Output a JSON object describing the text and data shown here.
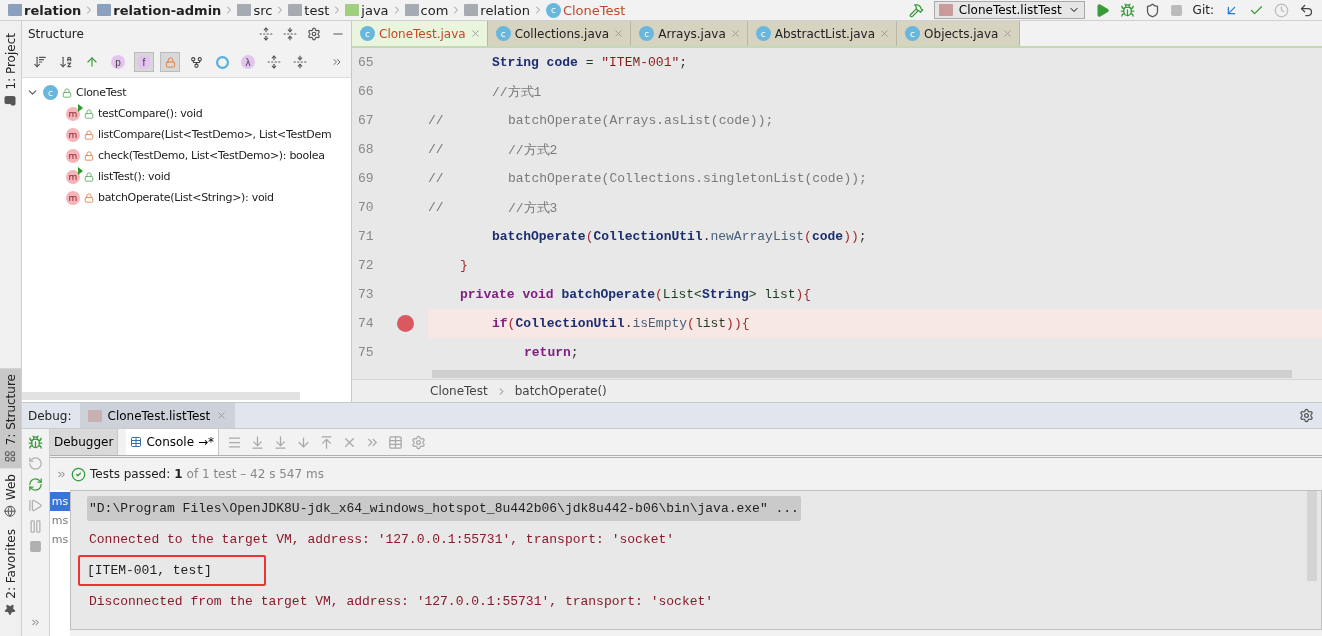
{
  "breadcrumbs": [
    {
      "label": "relation",
      "kind": "module"
    },
    {
      "label": "relation-admin",
      "kind": "module"
    },
    {
      "label": "src",
      "kind": "folder"
    },
    {
      "label": "test",
      "kind": "folder"
    },
    {
      "label": "java",
      "kind": "source"
    },
    {
      "label": "com",
      "kind": "package"
    },
    {
      "label": "relation",
      "kind": "package"
    },
    {
      "label": "CloneTest",
      "kind": "class",
      "badge": "c"
    }
  ],
  "run_config": {
    "label": "CloneTest.listTest"
  },
  "vcs": {
    "label": "Git:"
  },
  "tool_windows": [
    {
      "label": "1: Project",
      "kind": "project",
      "selected": false
    },
    {
      "label": "7: Structure",
      "kind": "structure",
      "selected": true
    },
    {
      "label": "Web",
      "kind": "web",
      "selected": false
    },
    {
      "label": "2: Favorites",
      "kind": "favorites",
      "selected": false
    }
  ],
  "structure": {
    "title": "Structure",
    "toolbar": [
      {
        "kind": "sort-visibility",
        "on": false
      },
      {
        "kind": "sort-alpha",
        "on": false
      },
      {
        "kind": "inherited",
        "on": false
      },
      {
        "kind": "letter",
        "glyph": "p",
        "on": false
      },
      {
        "kind": "letter",
        "glyph": "f",
        "on": true
      },
      {
        "kind": "lock",
        "on": true
      },
      {
        "kind": "fork",
        "on": false
      },
      {
        "kind": "ring",
        "on": false
      },
      {
        "kind": "letter",
        "glyph": "λ",
        "on": false
      },
      {
        "kind": "expand",
        "on": false
      },
      {
        "kind": "collapse",
        "on": false
      }
    ],
    "tree": [
      {
        "label": "CloneTest",
        "badge": "c",
        "expanded": true,
        "children": [
          {
            "label": "testCompare(): void",
            "badge": "m",
            "private": false,
            "runnable": true
          },
          {
            "label": "listCompare(List<TestDemo>, List<TestDem",
            "badge": "m",
            "private": true,
            "runnable": false
          },
          {
            "label": "check(TestDemo, List<TestDemo>): boolea",
            "badge": "m",
            "private": true,
            "runnable": false
          },
          {
            "label": "listTest(): void",
            "badge": "m",
            "private": false,
            "runnable": true
          },
          {
            "label": "batchOperate(List<String>): void",
            "badge": "m",
            "private": true,
            "runnable": false
          }
        ]
      }
    ]
  },
  "editor": {
    "tabs": [
      {
        "label": "CloneTest.java",
        "badge": "c",
        "selected": true
      },
      {
        "label": "Collections.java",
        "badge": "c",
        "selected": false
      },
      {
        "label": "Arrays.java",
        "badge": "c",
        "selected": false
      },
      {
        "label": "AbstractList.java",
        "badge": "c",
        "selected": false
      },
      {
        "label": "Objects.java",
        "badge": "c",
        "selected": false
      }
    ],
    "lines": [
      {
        "number": "65",
        "breakpoint": false,
        "tokens": [
          {
            "kind": "name",
            "text": "String code"
          },
          {
            "kind": "plain",
            "text": " = "
          },
          {
            "kind": "str",
            "text": "\"ITEM-001\""
          },
          {
            "kind": "punct",
            "text": ";"
          }
        ]
      },
      {
        "number": "66",
        "breakpoint": false,
        "tokens": [
          {
            "kind": "comment",
            "text": "//方式1"
          }
        ]
      },
      {
        "number": "67",
        "breakpoint": false,
        "lead": "//",
        "tokens": [
          {
            "kind": "comment",
            "text": "batchOperate(Arrays.asList(code));"
          }
        ]
      },
      {
        "number": "68",
        "breakpoint": false,
        "lead": "//",
        "tokens": [
          {
            "kind": "comment",
            "text": "//方式2"
          }
        ]
      },
      {
        "number": "69",
        "breakpoint": false,
        "lead": "//",
        "tokens": [
          {
            "kind": "comment",
            "text": "batchOperate(Collections.singletonList(code));"
          }
        ]
      },
      {
        "number": "70",
        "breakpoint": false,
        "lead": "//",
        "tokens": [
          {
            "kind": "comment",
            "text": "//方式3"
          }
        ]
      },
      {
        "number": "71",
        "breakpoint": false,
        "tokens": [
          {
            "kind": "name",
            "text": "batchOperate"
          },
          {
            "kind": "paren",
            "text": "("
          },
          {
            "kind": "name",
            "text": "CollectionUtil"
          },
          {
            "kind": "punct",
            "text": "."
          },
          {
            "kind": "call",
            "text": "newArrayList"
          },
          {
            "kind": "paren",
            "text": "("
          },
          {
            "kind": "name",
            "text": "code"
          },
          {
            "kind": "paren",
            "text": "))"
          },
          {
            "kind": "punct",
            "text": ";"
          }
        ]
      },
      {
        "number": "72",
        "breakpoint": false,
        "tokens": [
          {
            "kind": "paren",
            "text": "}"
          }
        ]
      },
      {
        "number": "73",
        "breakpoint": false,
        "tokens": [
          {
            "kind": "kw",
            "text": "private void "
          },
          {
            "kind": "name",
            "text": "batchOperate"
          },
          {
            "kind": "paren",
            "text": "("
          },
          {
            "kind": "plain",
            "text": "List<"
          },
          {
            "kind": "name",
            "text": "String"
          },
          {
            "kind": "plain",
            "text": "> list"
          },
          {
            "kind": "paren",
            "text": "){"
          }
        ]
      },
      {
        "number": "74",
        "breakpoint": true,
        "tokens": [
          {
            "kind": "kw",
            "text": "if"
          },
          {
            "kind": "paren",
            "text": "("
          },
          {
            "kind": "name",
            "text": "CollectionUtil"
          },
          {
            "kind": "punct",
            "text": "."
          },
          {
            "kind": "call",
            "text": "isEmpty"
          },
          {
            "kind": "paren",
            "text": "("
          },
          {
            "kind": "plain",
            "text": "list"
          },
          {
            "kind": "paren",
            "text": ")){"
          }
        ]
      },
      {
        "number": "75",
        "breakpoint": false,
        "tokens": [
          {
            "kind": "kw",
            "text": "return"
          },
          {
            "kind": "punct",
            "text": ";"
          }
        ]
      }
    ],
    "footer": [
      "CloneTest",
      "batchOperate()"
    ]
  },
  "debug": {
    "title": "Debug:",
    "session": "CloneTest.listTest",
    "tabs": [
      {
        "label": "Debugger",
        "selected": false
      },
      {
        "label": "Console",
        "pin": "→*",
        "selected": true
      }
    ],
    "side_actions": [
      {
        "kind": "bug",
        "disabled": false
      },
      {
        "kind": "rerun-failed",
        "disabled": true
      },
      {
        "kind": "reload",
        "disabled": false
      },
      {
        "kind": "resume",
        "disabled": true
      },
      {
        "kind": "pause",
        "disabled": true
      },
      {
        "kind": "stop",
        "disabled": true
      }
    ],
    "toolbar": [
      {
        "kind": "menu"
      },
      {
        "kind": "step-over"
      },
      {
        "kind": "step-into"
      },
      {
        "kind": "force-step"
      },
      {
        "kind": "step-out"
      },
      {
        "kind": "drop-frame"
      },
      {
        "kind": "run-to-cursor"
      },
      {
        "kind": "table"
      },
      {
        "kind": "settings"
      }
    ],
    "status": {
      "label": "Tests passed:",
      "count": "1",
      "detail": "of 1 test – 42 s 547 ms"
    },
    "times": [
      {
        "label": "ms",
        "selected": true
      },
      {
        "label": "ms",
        "selected": false
      },
      {
        "label": "ms",
        "selected": false
      }
    ],
    "console": [
      {
        "kind": "command",
        "boxed": false,
        "text": "\"D:\\Program Files\\OpenJDK8U-jdk_x64_windows_hotspot_8u442b06\\jdk8u442-b06\\bin\\java.exe\" ..."
      },
      {
        "kind": "system",
        "boxed": false,
        "text": "Connected to the target VM, address: '127.0.0.1:55731', transport: 'socket'"
      },
      {
        "kind": "output",
        "boxed": true,
        "text": "[ITEM-001, test]"
      },
      {
        "kind": "system",
        "boxed": false,
        "text": "Disconnected from the target VM, address: '127.0.0.1:55731', transport: 'socket'"
      }
    ]
  }
}
